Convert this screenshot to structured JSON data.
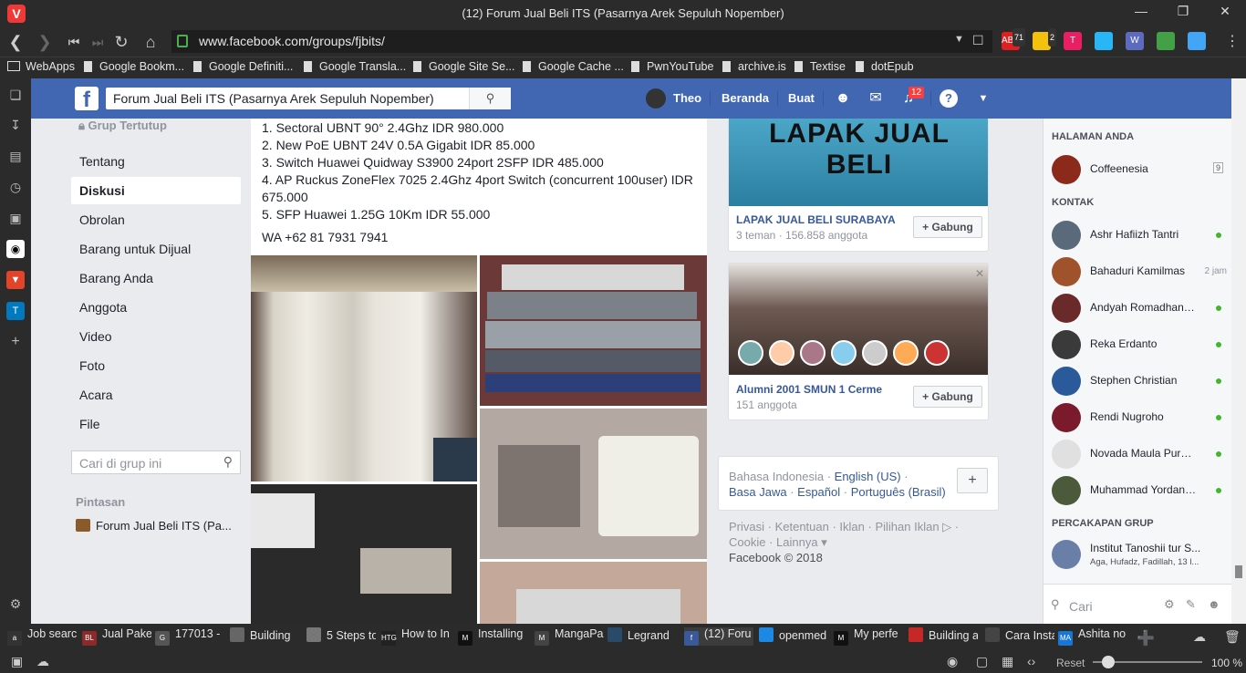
{
  "window": {
    "title": "(12) Forum Jual Beli ITS (Pasarnya Arek Sepuluh Nopember)"
  },
  "address_bar": {
    "url": "www.facebook.com/groups/fjbits/"
  },
  "extensions": [
    {
      "name": "adblock-icon",
      "badge": "71",
      "label": "ABP",
      "color": "#e02020"
    },
    {
      "name": "notes-icon",
      "badge": "2",
      "label": "",
      "color": "#f4c20d"
    },
    {
      "name": "todoist-icon",
      "badge": "",
      "label": "T",
      "color": "#e91e63"
    },
    {
      "name": "share-icon",
      "badge": "",
      "label": "",
      "color": "#29b6f6"
    },
    {
      "name": "w-icon",
      "badge": "",
      "label": "W",
      "color": "#5c6bc0"
    },
    {
      "name": "leaf-icon",
      "badge": "",
      "label": "",
      "color": "#43a047"
    },
    {
      "name": "compass-icon",
      "badge": "",
      "label": "",
      "color": "#42a5f5"
    }
  ],
  "bookmarks": [
    "WebApps",
    "Google Bookm...",
    "Google Definiti...",
    "Google Transla...",
    "Google Site Se...",
    "Google Cache ...",
    "PwnYouTube",
    "archive.is",
    "Textise",
    "dotEpub"
  ],
  "fb_header": {
    "search_value": "Forum Jual Beli ITS (Pasarnya Arek Sepuluh Nopember)",
    "user": "Theo",
    "home": "Beranda",
    "create": "Buat",
    "notification_count": "12"
  },
  "left_nav": {
    "closed_group": "Grup Tertutup",
    "items": [
      "Tentang",
      "Diskusi",
      "Obrolan",
      "Barang untuk Dijual",
      "Barang Anda",
      "Anggota",
      "Video",
      "Foto",
      "Acara",
      "File"
    ],
    "active": "Diskusi",
    "search_placeholder": "Cari di grup ini",
    "shortcuts_title": "Pintasan",
    "shortcut": "Forum Jual Beli ITS (Pa..."
  },
  "post": {
    "lines": [
      "1. Sectoral UBNT 90° 2.4Ghz IDR 980.000",
      "2. New PoE UBNT 24V 0.5A Gigabit IDR 85.000",
      "3. Switch Huawei Quidway S3900 24port 2SFP IDR 485.000",
      "4. AP Ruckus ZoneFlex 7025 2.4Ghz 4port Switch (concurrent 100user) IDR",
      "675.000",
      "5. SFP Huawei 1.25G 10Km IDR 55.000"
    ],
    "contact": "WA +62 81 7931 7941"
  },
  "suggested_groups": [
    {
      "banner": "LAPAK JUAL BELI",
      "name": "LAPAK JUAL BELI SURABAYA",
      "meta": "3 teman · 156.858 anggota",
      "join": "+ Gabung"
    },
    {
      "name": "Alumni 2001 SMUN 1 Cerme",
      "meta": "151 anggota",
      "join": "+ Gabung"
    }
  ],
  "languages": {
    "current": "Bahasa Indonesia",
    "others": [
      "English (US)",
      "Basa Jawa",
      "Español",
      "Português (Brasil)"
    ],
    "add": "+"
  },
  "footer": {
    "links": [
      "Privasi",
      "Ketentuan",
      "Iklan",
      "Pilihan Iklan",
      "Cookie",
      "Lainnya"
    ],
    "copyright": "Facebook © 2018"
  },
  "chat": {
    "pages_title": "HALAMAN ANDA",
    "page": {
      "name": "Coffeenesia",
      "count": "9"
    },
    "contacts_title": "KONTAK",
    "contacts": [
      {
        "name": "Ashr Hafiizh Tantri",
        "status": "online",
        "time": ""
      },
      {
        "name": "Bahaduri Kamilmas",
        "status": "",
        "time": "2 jam"
      },
      {
        "name": "Andyah Romadhanti ...",
        "status": "online",
        "time": ""
      },
      {
        "name": "Reka Erdanto",
        "status": "online",
        "time": ""
      },
      {
        "name": "Stephen Christian",
        "status": "online",
        "time": ""
      },
      {
        "name": "Rendi Nugroho",
        "status": "online",
        "time": ""
      },
      {
        "name": "Novada Maula Purwadi",
        "status": "online",
        "time": ""
      },
      {
        "name": "Muhammad Yordanis...",
        "status": "online",
        "time": ""
      }
    ],
    "groups_title": "PERCAKAPAN GRUP",
    "group_chat": {
      "name": "Institut Tanoshii tur S...",
      "members": "Aga, Hufadz, Fadillah, 13 l..."
    },
    "search_placeholder": "Cari"
  },
  "tabs": [
    {
      "label": "Job searc",
      "fav": "a"
    },
    {
      "label": "Jual Pake",
      "fav": "BL"
    },
    {
      "label": "177013 -",
      "fav": "G"
    },
    {
      "label": "Building",
      "fav": ""
    },
    {
      "label": "5 Steps to",
      "fav": ""
    },
    {
      "label": "How to In",
      "fav": "HTG"
    },
    {
      "label": "Installing",
      "fav": "M"
    },
    {
      "label": "MangaPa",
      "fav": "M"
    },
    {
      "label": "Legrand",
      "fav": ""
    },
    {
      "label": "(12) Foru",
      "fav": "f"
    },
    {
      "label": "openmed",
      "fav": ""
    },
    {
      "label": "My perfe",
      "fav": "M"
    },
    {
      "label": "Building a",
      "fav": ""
    },
    {
      "label": "Cara Insta",
      "fav": ""
    },
    {
      "label": "Ashita no",
      "fav": "MA"
    }
  ],
  "statusbar": {
    "reset": "Reset",
    "zoom": "100 %"
  }
}
